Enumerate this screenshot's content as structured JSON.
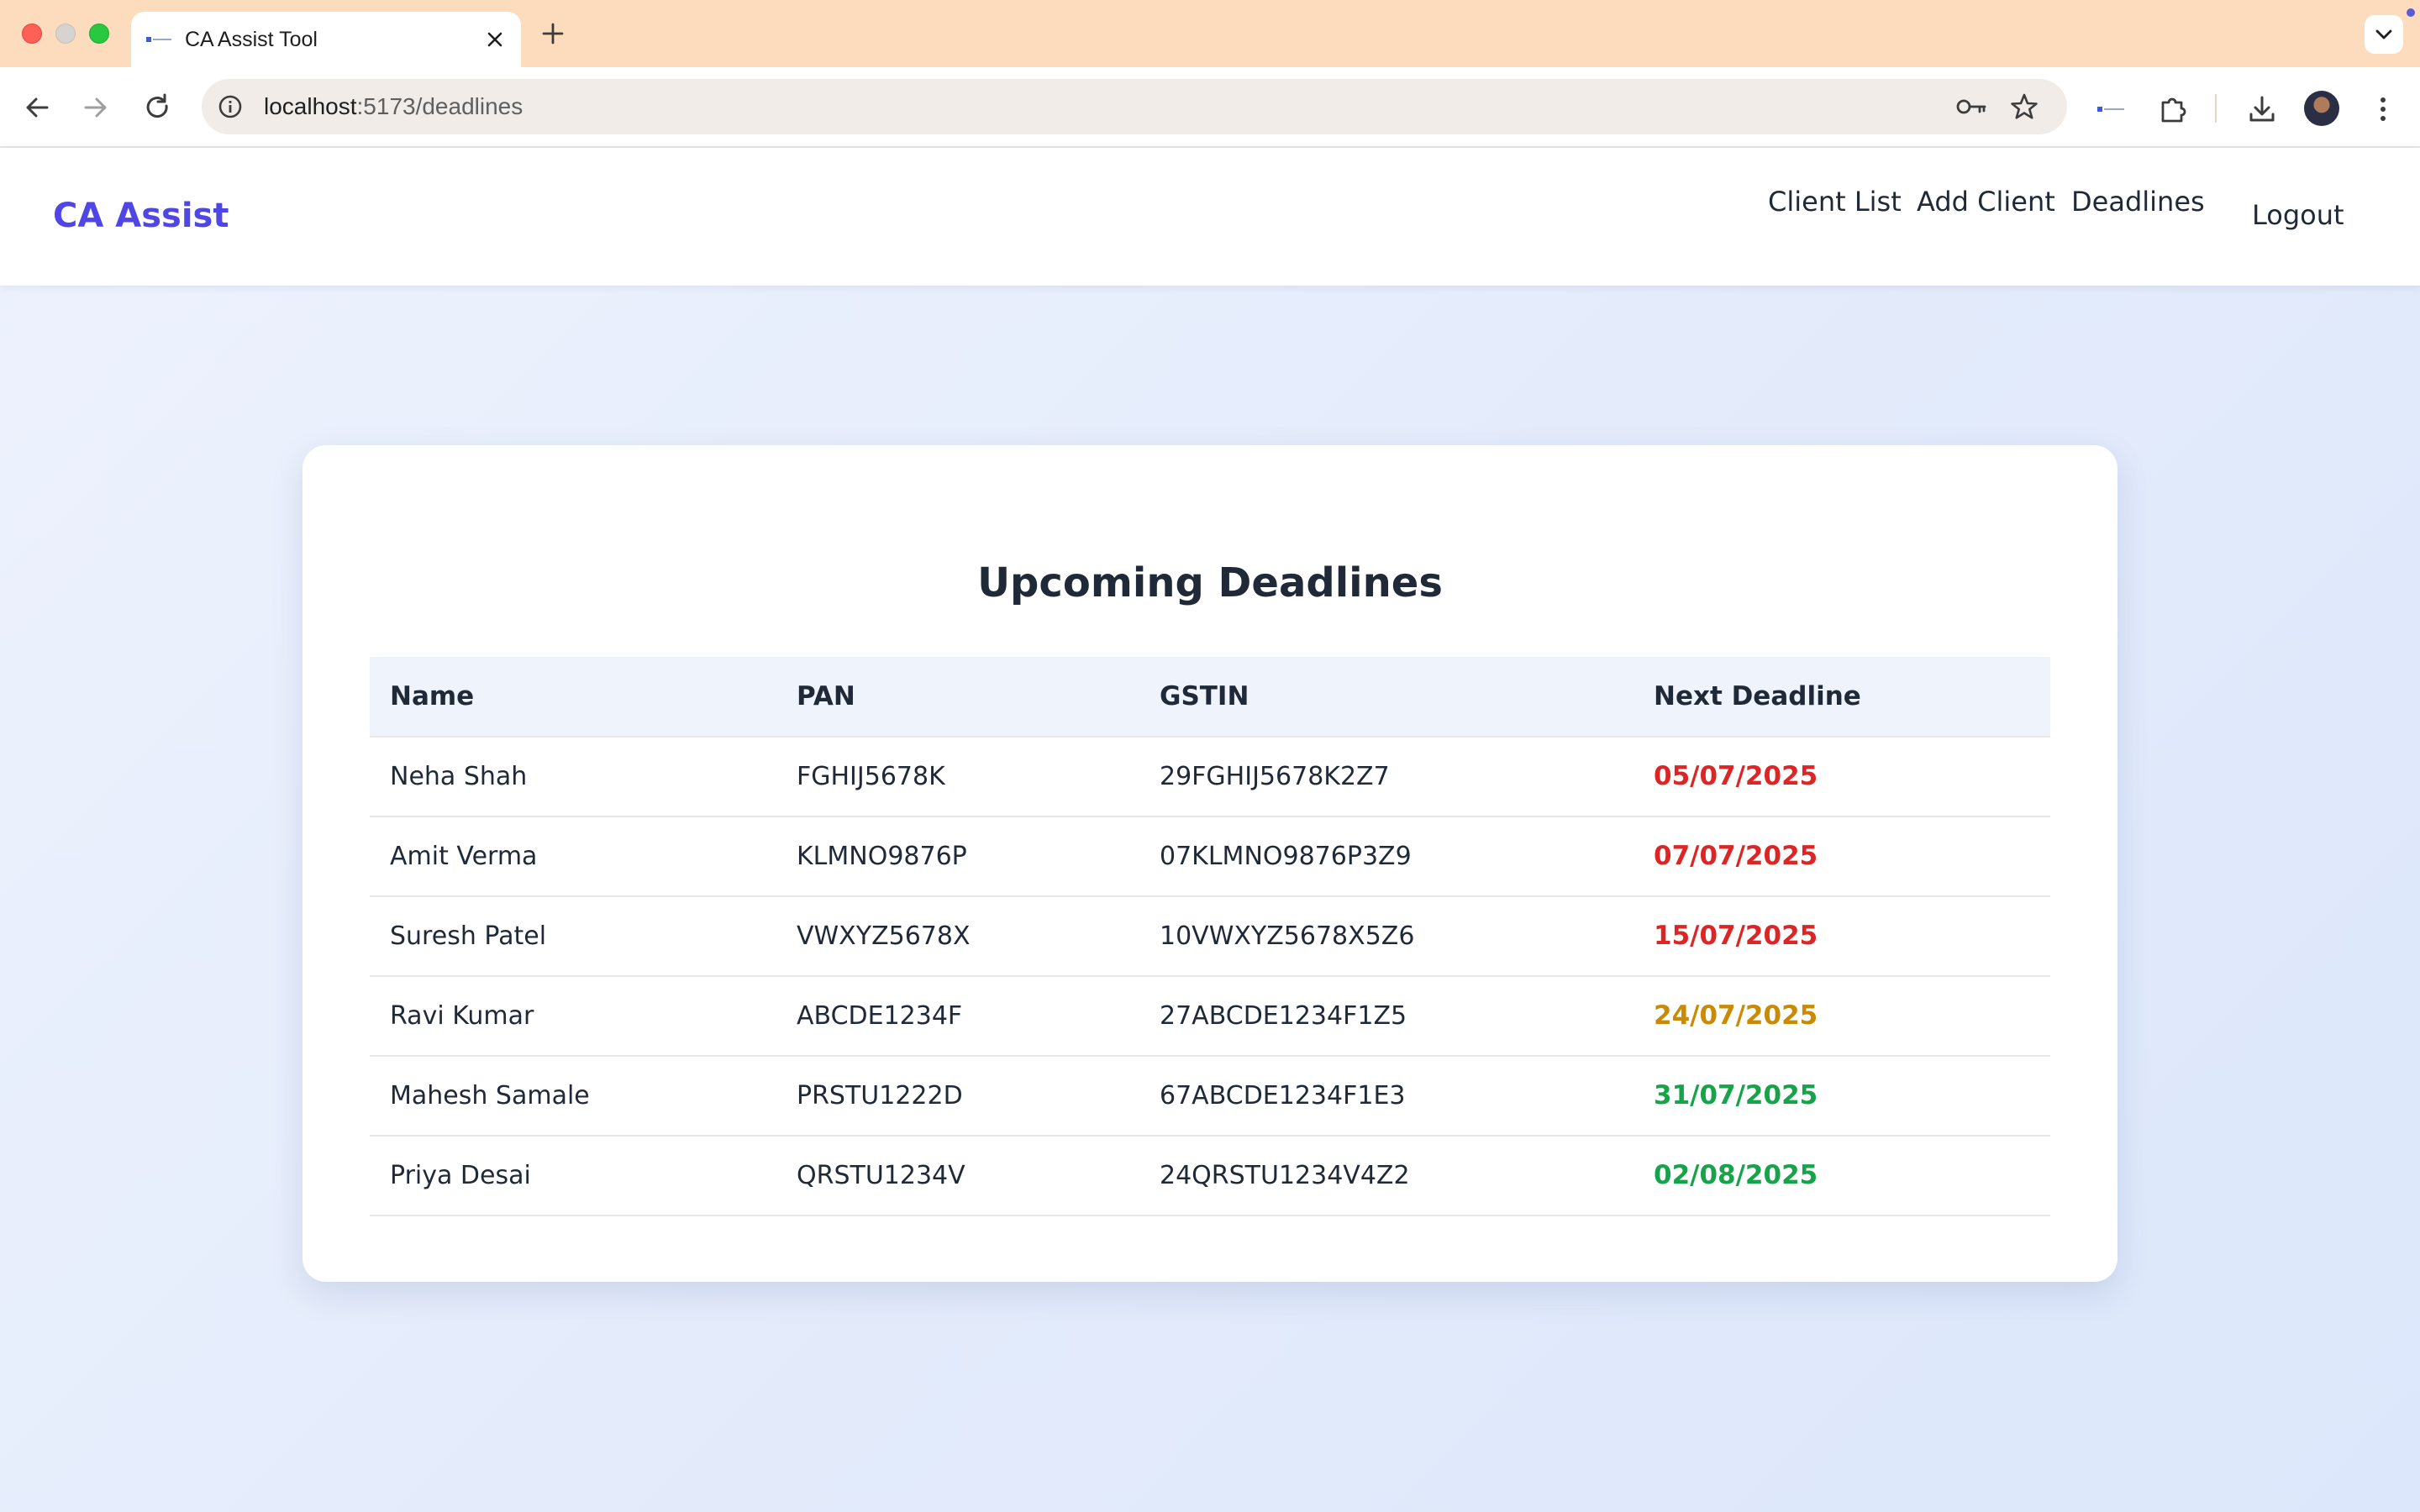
{
  "browser": {
    "tab_title": "CA Assist Tool",
    "url_host": "localhost",
    "url_path": ":5173/deadlines"
  },
  "app": {
    "brand": "CA Assist",
    "nav": {
      "client_list": "Client List",
      "add_client": "Add Client",
      "deadlines": "Deadlines",
      "logout": "Logout"
    },
    "title": "Upcoming Deadlines",
    "table": {
      "headers": [
        "Name",
        "PAN",
        "GSTIN",
        "Next Deadline"
      ],
      "rows": [
        {
          "name": "Neha Shah",
          "pan": "FGHIJ5678K",
          "gstin": "29FGHIJ5678K2Z7",
          "deadline": "05/07/2025",
          "color": "#dc2626"
        },
        {
          "name": "Amit Verma",
          "pan": "KLMNO9876P",
          "gstin": "07KLMNO9876P3Z9",
          "deadline": "07/07/2025",
          "color": "#dc2626"
        },
        {
          "name": "Suresh Patel",
          "pan": "VWXYZ5678X",
          "gstin": "10VWXYZ5678X5Z6",
          "deadline": "15/07/2025",
          "color": "#dc2626"
        },
        {
          "name": "Ravi Kumar",
          "pan": "ABCDE1234F",
          "gstin": "27ABCDE1234F1Z5",
          "deadline": "24/07/2025",
          "color": "#ca8a04"
        },
        {
          "name": "Mahesh Samale",
          "pan": "PRSTU1222D",
          "gstin": "67ABCDE1234F1E3",
          "deadline": "31/07/2025",
          "color": "#16a34a"
        },
        {
          "name": "Priya Desai",
          "pan": "QRSTU1234V",
          "gstin": "24QRSTU1234V4Z2",
          "deadline": "02/08/2025",
          "color": "#16a34a"
        }
      ]
    }
  },
  "colors": {
    "brand": "#4f46e5",
    "overdue": "#dc2626",
    "soon": "#ca8a04",
    "ok": "#16a34a",
    "tabstrip": "#fddbbd"
  },
  "icons": [
    "back-arrow-icon",
    "forward-arrow-icon",
    "reload-icon",
    "info-icon",
    "key-icon",
    "star-icon",
    "extension-icon",
    "puzzle-icon",
    "download-icon",
    "kebab-menu-icon",
    "close-icon",
    "plus-icon",
    "chevron-down-icon"
  ]
}
